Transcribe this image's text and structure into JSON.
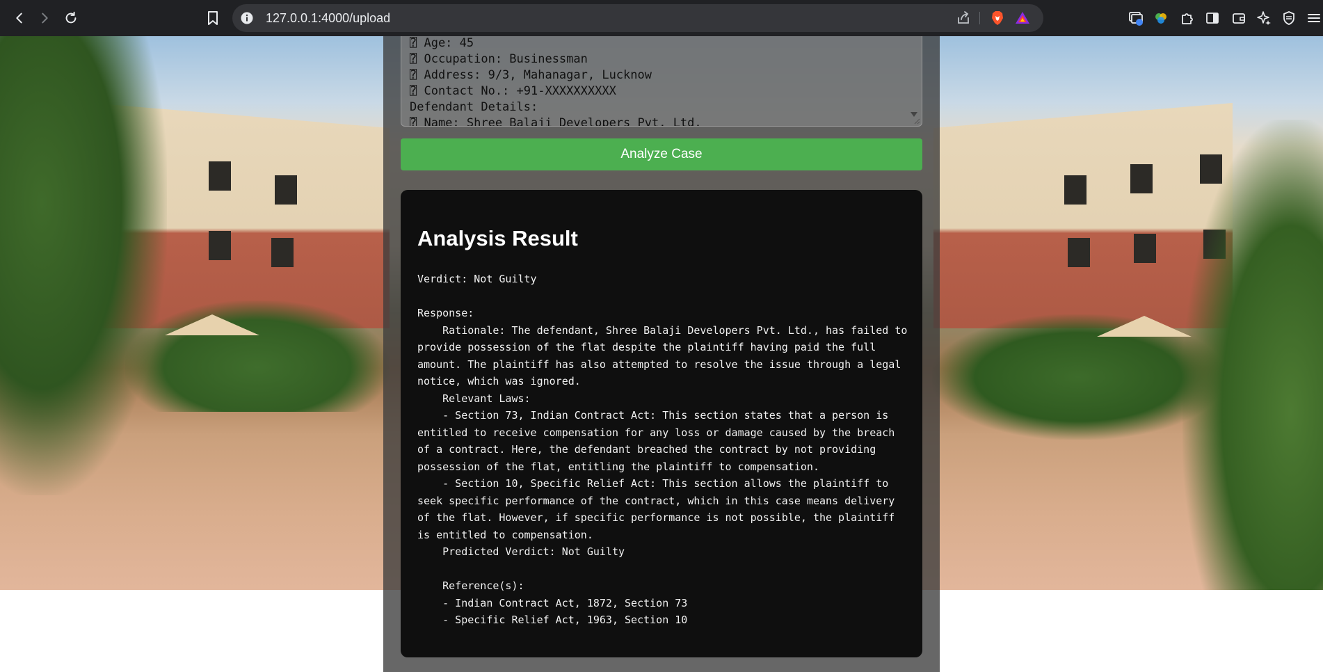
{
  "browser": {
    "url": "127.0.0.1:4000/upload"
  },
  "case_input": {
    "lines": [
      "⍰ Age: 45",
      "⍰ Occupation: Businessman",
      "⍰ Address: 9/3, Mahanagar, Lucknow",
      "⍰ Contact No.: +91-XXXXXXXXXX",
      "Defendant Details:",
      "⍰ Name: Shree Balaji Developers Pvt. Ltd."
    ]
  },
  "analyze_button": {
    "label": "Analyze Case"
  },
  "result": {
    "title": "Analysis Result",
    "verdict": "Verdict: Not Guilty",
    "response_label": "Response:",
    "rationale": "    Rationale: The defendant, Shree Balaji Developers Pvt. Ltd., has failed to provide possession of the flat despite the plaintiff having paid the full amount. The plaintiff has also attempted to resolve the issue through a legal notice, which was ignored.",
    "relevant_laws_label": "    Relevant Laws:",
    "law_1": "    - Section 73, Indian Contract Act: This section states that a person is entitled to receive compensation for any loss or damage caused by the breach of a contract. Here, the defendant breached the contract by not providing possession of the flat, entitling the plaintiff to compensation.",
    "law_2": "    - Section 10, Specific Relief Act: This section allows the plaintiff to seek specific performance of the contract, which in this case means delivery of the flat. However, if specific performance is not possible, the plaintiff is entitled to compensation.",
    "predicted_verdict": "    Predicted Verdict: Not Guilty",
    "references_label": "    Reference(s):",
    "reference_1": "    - Indian Contract Act, 1872, Section 73",
    "reference_2": "    - Specific Relief Act, 1963, Section 10"
  }
}
